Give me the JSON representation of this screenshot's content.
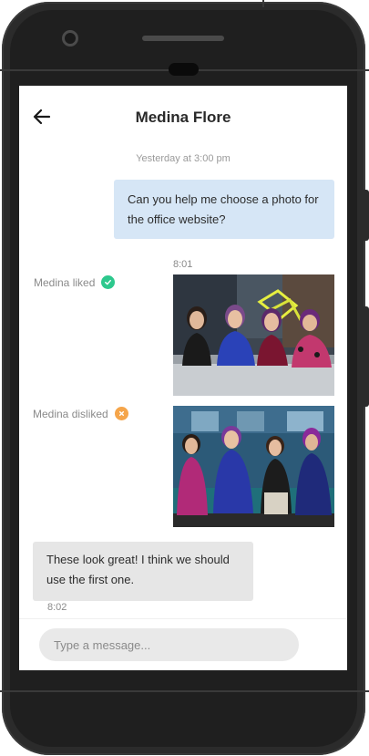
{
  "chat": {
    "title": "Medina Flore",
    "date_stamp": "Yesterday at 3:00 pm",
    "outgoing_message": "Can you help me choose a photo for the office website?",
    "photo_time": "8:01",
    "reactions": [
      {
        "label": "Medina liked",
        "icon": "check-icon",
        "color": "#2dc88d"
      },
      {
        "label": "Medina disliked",
        "icon": "x-icon",
        "color": "#f5a54a"
      }
    ],
    "incoming_message": "These look great! I think we should use the first one.",
    "incoming_time": "8:02"
  },
  "composer": {
    "placeholder": "Type a message..."
  }
}
